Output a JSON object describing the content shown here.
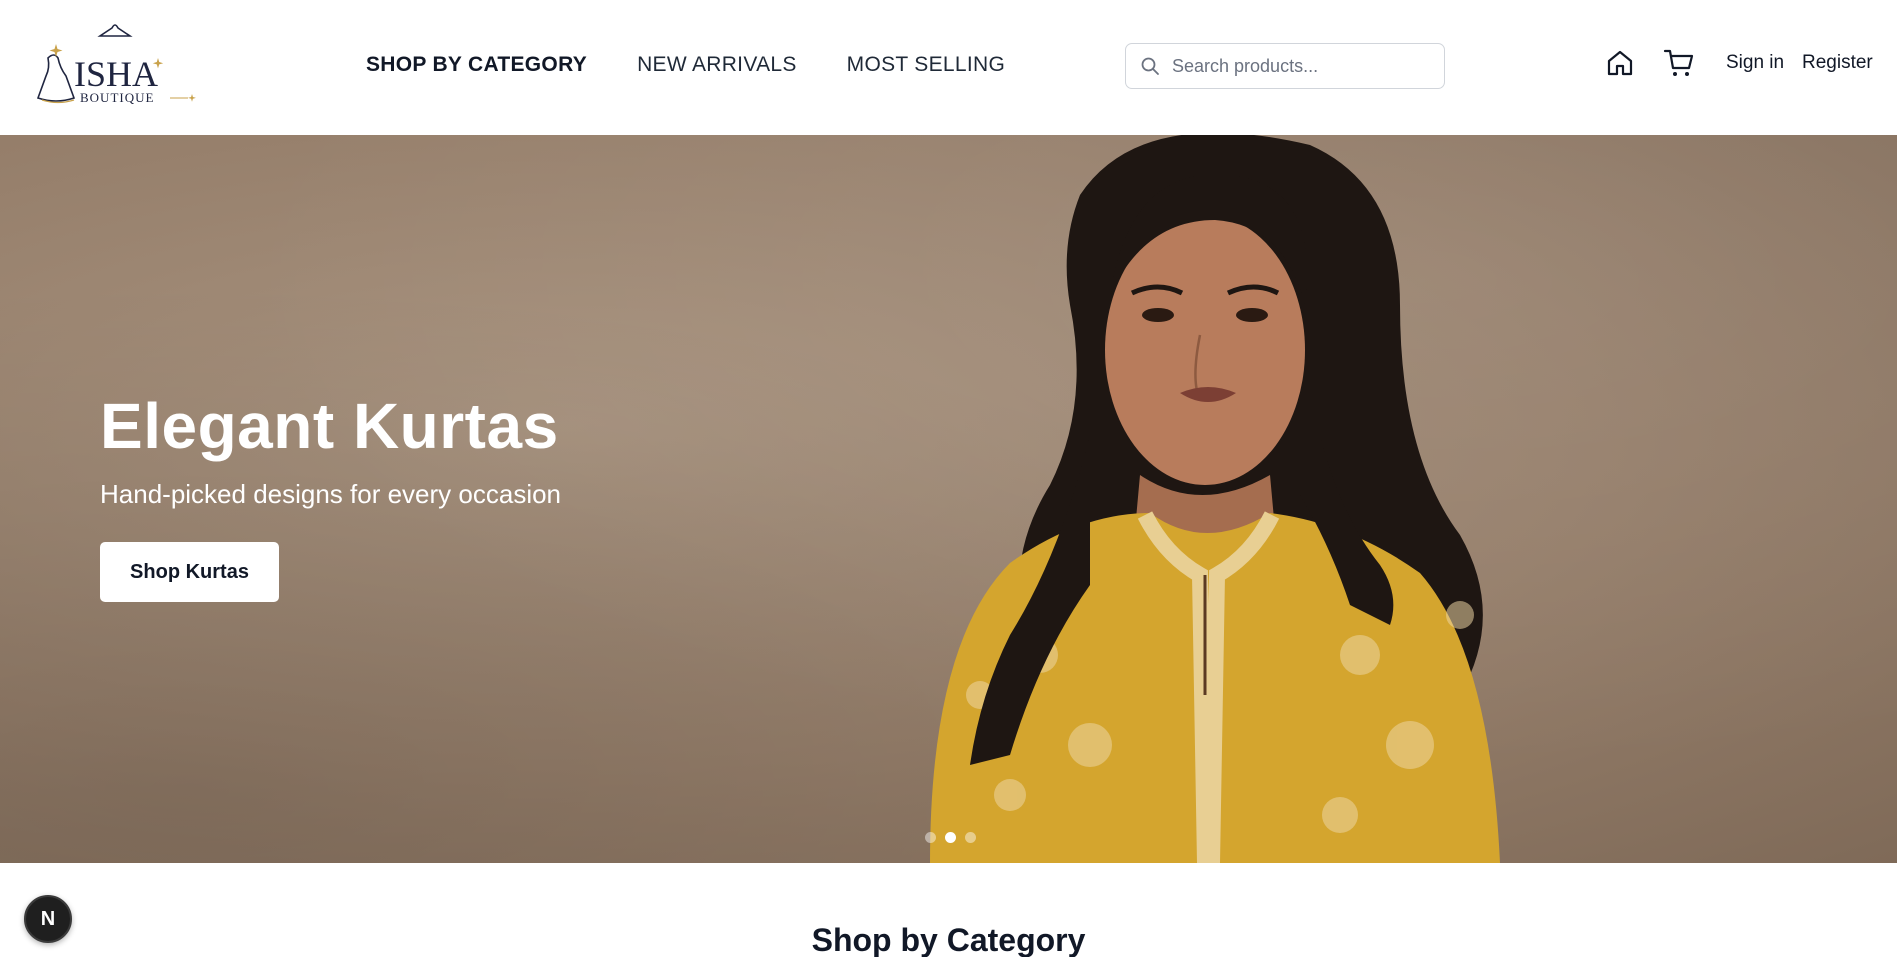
{
  "brand": {
    "name": "ISHA",
    "tagline": "BOUTIQUE"
  },
  "nav": {
    "items": [
      {
        "label": "SHOP BY CATEGORY",
        "active": true
      },
      {
        "label": "NEW ARRIVALS",
        "active": false
      },
      {
        "label": "MOST SELLING",
        "active": false
      }
    ]
  },
  "search": {
    "placeholder": "Search products...",
    "icon": "search-icon"
  },
  "header_actions": {
    "home_icon": "home-icon",
    "cart_icon": "cart-icon",
    "sign_in": "Sign in",
    "register": "Register"
  },
  "hero": {
    "title": "Elegant Kurtas",
    "subtitle": "Hand-picked designs for every occasion",
    "cta": "Shop Kurtas",
    "slides_total": 3,
    "active_slide": 2
  },
  "section": {
    "title": "Shop by Category"
  },
  "dev_badge": {
    "label": "N"
  },
  "colors": {
    "hero_bg": "#957e6a",
    "kurta": "#d4a52e",
    "text": "#111827"
  }
}
